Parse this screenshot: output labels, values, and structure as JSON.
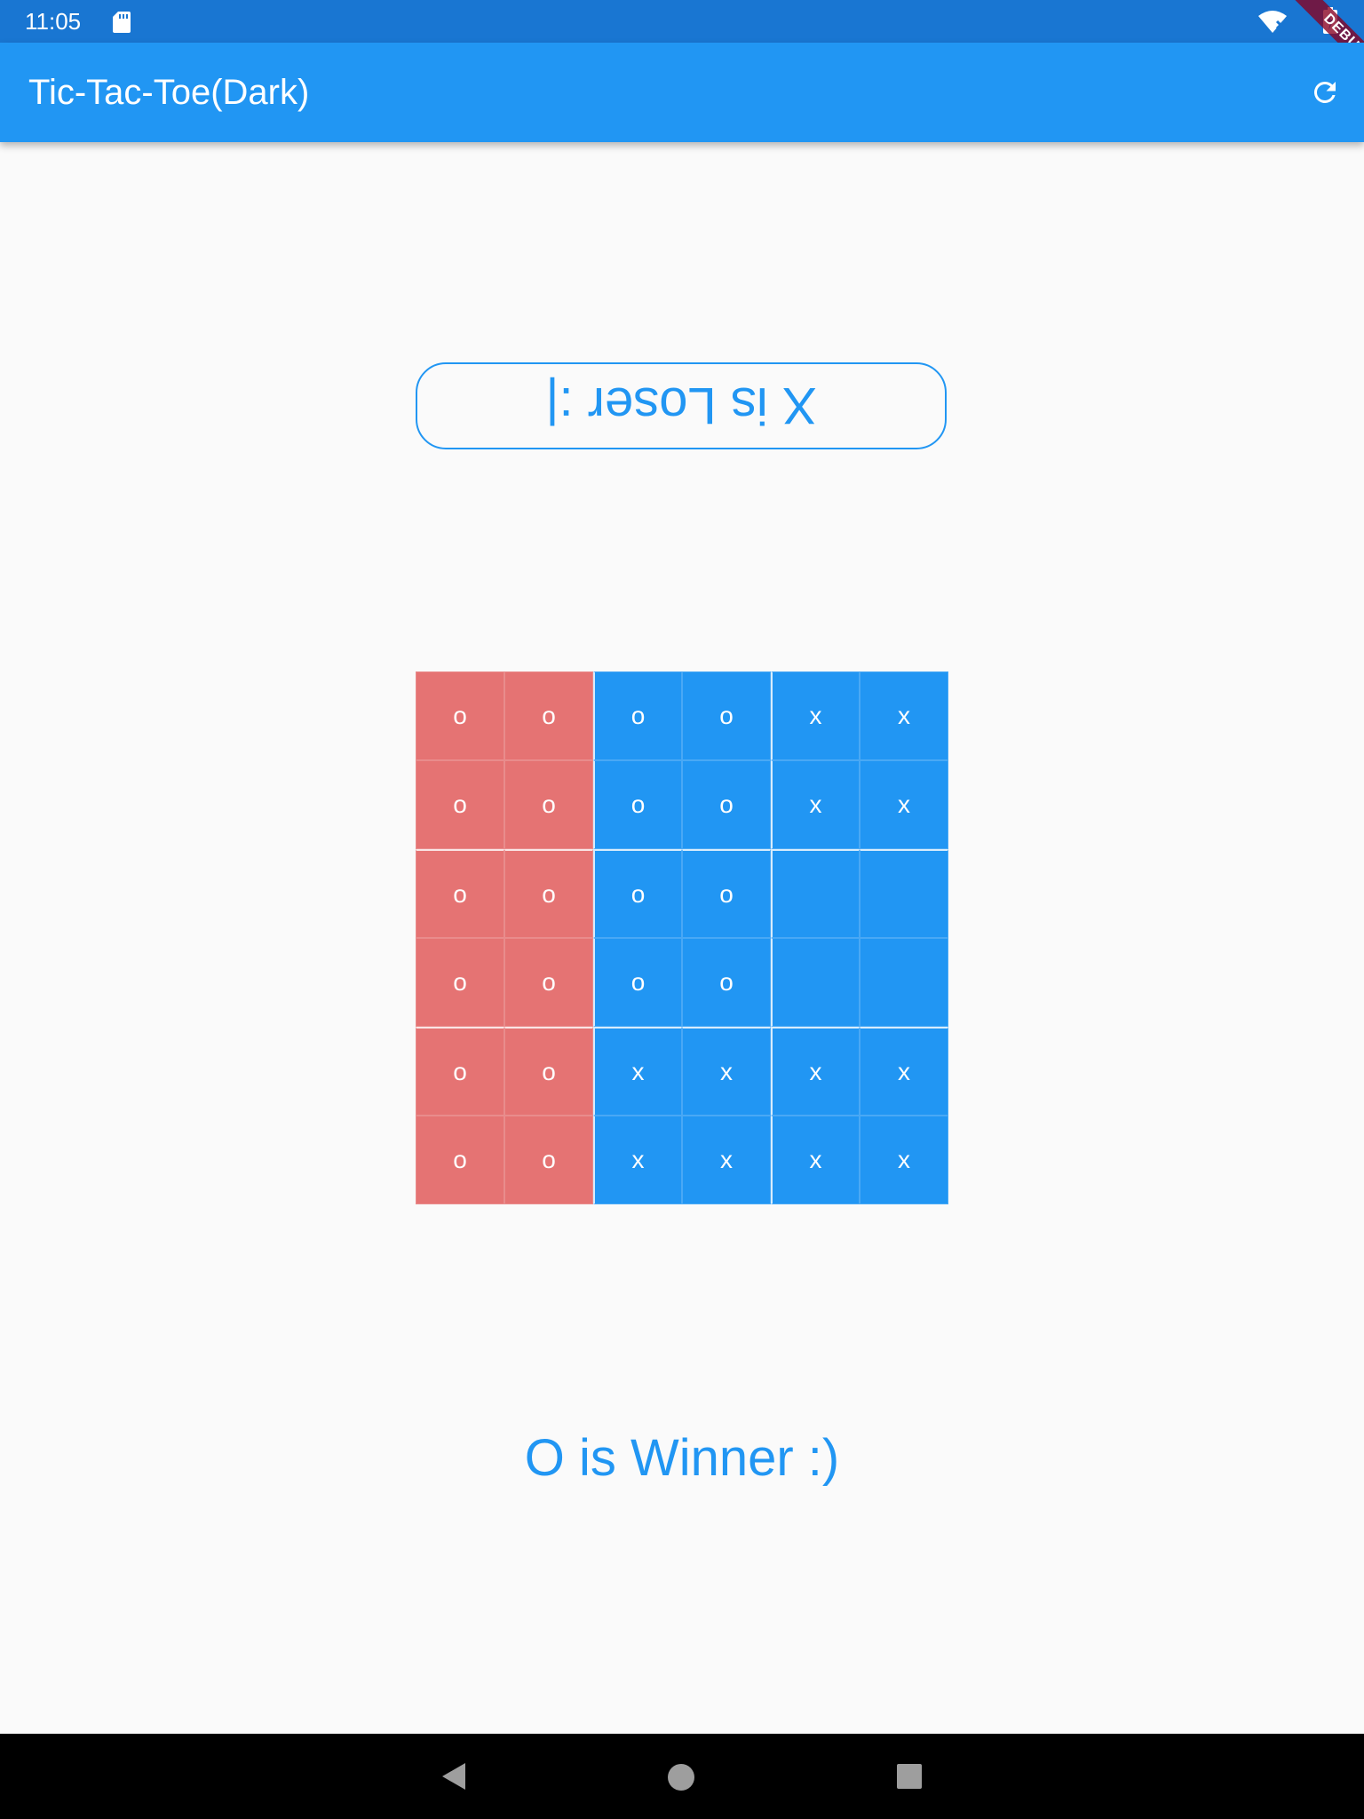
{
  "status_bar": {
    "time": "11:05",
    "debug_label": "DEBUG",
    "icons": [
      "sd-card-icon",
      "wifi-icon",
      "battery-icon"
    ]
  },
  "app_bar": {
    "title": "Tic-Tac-Toe(Dark)",
    "action_icon": "refresh-icon",
    "background": "#2196f3"
  },
  "game": {
    "loser_text": "X is Loser :|",
    "winner_text": "O is Winner :)",
    "accent_color": "#2196f3",
    "board": [
      [
        "o",
        "o",
        "o",
        "o",
        "x",
        "x"
      ],
      [
        "o",
        "o",
        "o",
        "o",
        "x",
        "x"
      ],
      [
        "o",
        "o",
        "o",
        "o",
        "",
        ""
      ],
      [
        "o",
        "o",
        "o",
        "o",
        "",
        ""
      ],
      [
        "o",
        "o",
        "x",
        "x",
        "x",
        "x"
      ],
      [
        "o",
        "o",
        "x",
        "x",
        "x",
        "x"
      ]
    ],
    "highlight_columns": [
      0,
      1
    ],
    "colors": {
      "cell": "#2196f3",
      "highlight": "#e57373",
      "text": "#ffffff"
    }
  },
  "nav_bar": {
    "icons": [
      "back-icon",
      "home-icon",
      "recents-icon"
    ]
  }
}
